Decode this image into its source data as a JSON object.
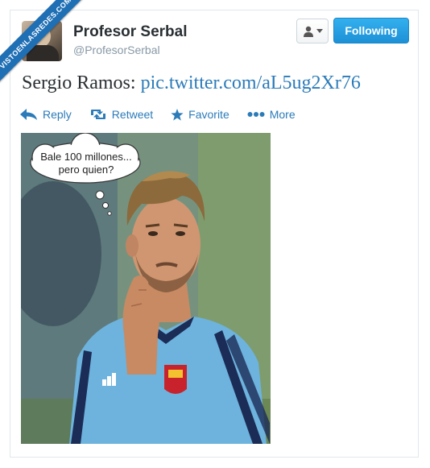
{
  "watermark": "VISTOENLASREDES.COM",
  "profile": {
    "name": "Profesor Serbal",
    "handle": "@ProfesorSerbal"
  },
  "buttons": {
    "follow_label": "Following"
  },
  "tweet": {
    "text_prefix": "Sergio Ramos: ",
    "link": "pic.twitter.com/aL5ug2Xr76"
  },
  "actions": {
    "reply": "Reply",
    "retweet": "Retweet",
    "favorite": "Favorite",
    "more": "More"
  },
  "photo": {
    "bubble_line1": "Bale 100 millones...",
    "bubble_line2": "pero quien?"
  },
  "colors": {
    "link": "#2b7bb9",
    "follow_button": "#1d90d6",
    "ribbon": "#1f6fb5"
  }
}
